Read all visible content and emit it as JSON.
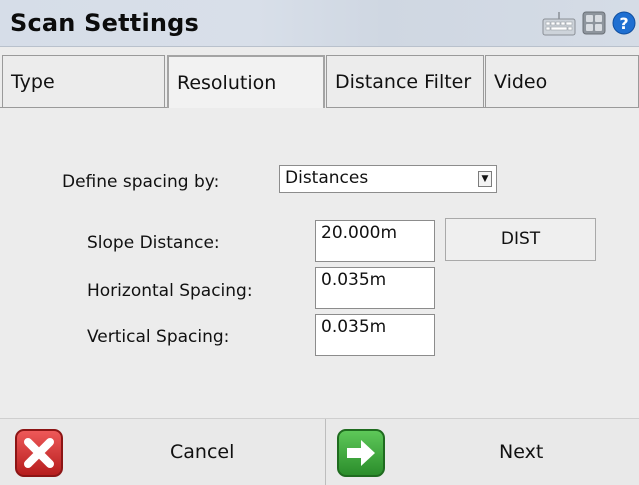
{
  "window": {
    "title": "Scan Settings",
    "icons": [
      "keyboard-icon",
      "calculator-icon",
      "help-icon"
    ]
  },
  "tabs": [
    {
      "label": "Type",
      "active": false
    },
    {
      "label": "Resolution",
      "active": true
    },
    {
      "label": "Distance Filter",
      "active": false
    },
    {
      "label": "Video",
      "active": false
    }
  ],
  "form": {
    "define_spacing_label": "Define spacing by:",
    "define_spacing_value": "Distances",
    "slope_distance_label": "Slope Distance:",
    "slope_distance_value": "20.000m",
    "dist_button_label": "DIST",
    "horizontal_spacing_label": "Horizontal Spacing:",
    "horizontal_spacing_value": "0.035m",
    "vertical_spacing_label": "Vertical Spacing:",
    "vertical_spacing_value": "0.035m"
  },
  "footer": {
    "cancel_label": "Cancel",
    "next_label": "Next"
  },
  "colors": {
    "titlebar": "#d6dde8",
    "background": "#ececec",
    "cancel_red": "#d92b2b",
    "next_green": "#3aa23a",
    "help_blue": "#1f6fd1"
  }
}
